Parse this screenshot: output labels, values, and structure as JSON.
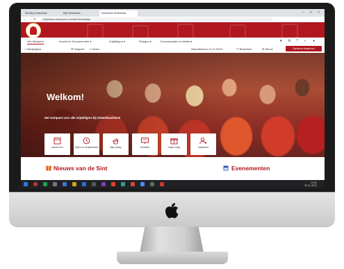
{
  "browser": {
    "tabs": [
      {
        "label": "Stichting Sinterklaas"
      },
      {
        "label": "Mijn Sinterklaas"
      },
      {
        "label": "Dashboard Sinterklaas"
      }
    ],
    "window_controls": {
      "minimize": "–",
      "maximize": "□",
      "close": "×"
    },
    "address": "sinterklaas.sharepoint.com/sites/Sinterklaas",
    "back_icon": "back-arrow-icon",
    "forward_icon": "forward-arrow-icon",
    "refresh_icon": "refresh-icon"
  },
  "site": {
    "brand_color": "#b0171f",
    "logo": "sinterklaas-logo"
  },
  "menu": {
    "items": [
      {
        "label": "Het Startpunt"
      },
      {
        "label": "Intocht en Evenementen ▾"
      },
      {
        "label": "Vrijwilligers ▾"
      },
      {
        "label": "Ploegen ▾"
      },
      {
        "label": "Communicatie en Media ▾"
      }
    ],
    "right_icons": [
      "★",
      "⚙",
      "?",
      "◐",
      "●"
    ]
  },
  "subbar": {
    "items": [
      {
        "label": "⌂ Startpagina"
      },
      {
        "label": "☰ Volgend"
      },
      {
        "label": "⇪ Delen"
      }
    ],
    "right_items": [
      {
        "label": "Gepubliceerd 11-11-2023"
      },
      {
        "label": "✎ Bewerken"
      },
      {
        "label": "⊕ Nieuw"
      }
    ],
    "cta_label": "Opnieuw beginnen"
  },
  "hero": {
    "title": "Welkom!",
    "subtitle": "Het startpunt voor alle vrijwilligers bij Sinterklaasfeest!",
    "tiles": [
      {
        "label": "Intocht info",
        "icon": "calendar-icon"
      },
      {
        "label": "Tijden en draaiboeken",
        "icon": "clock-icon"
      },
      {
        "label": "Mijn ploeg",
        "icon": "hand-icon"
      },
      {
        "label": "Verhalen",
        "icon": "presentation-icon"
      },
      {
        "label": "Hulp nodig",
        "icon": "gift-icon"
      },
      {
        "label": "Vacatures",
        "icon": "person-add-icon"
      }
    ]
  },
  "sections": {
    "news": {
      "title": "Nieuws van de Sint",
      "icon": "gift-icon"
    },
    "events": {
      "title": "Evenementen",
      "icon": "calendar-icon"
    }
  },
  "taskbar": {
    "time": "14:32",
    "date": "20-11-2023"
  }
}
